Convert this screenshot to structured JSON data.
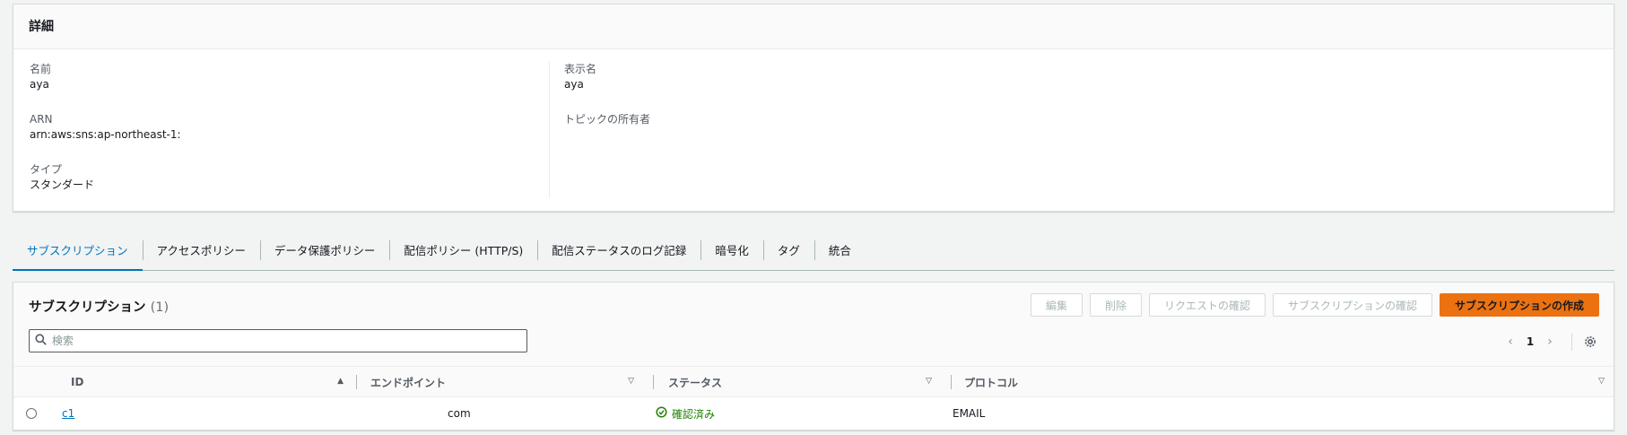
{
  "details": {
    "title": "詳細",
    "name_label": "名前",
    "name_value": "aya",
    "arn_label": "ARN",
    "arn_value": "arn:aws:sns:ap-northeast-1:",
    "type_label": "タイプ",
    "type_value": "スタンダード",
    "display_name_label": "表示名",
    "display_name_value": "aya",
    "owner_label": "トピックの所有者",
    "owner_value": ""
  },
  "tabs": [
    {
      "label": "サブスクリプション"
    },
    {
      "label": "アクセスポリシー"
    },
    {
      "label": "データ保護ポリシー"
    },
    {
      "label": "配信ポリシー (HTTP/S)"
    },
    {
      "label": "配信ステータスのログ記録"
    },
    {
      "label": "暗号化"
    },
    {
      "label": "タグ"
    },
    {
      "label": "統合"
    }
  ],
  "subscriptions": {
    "title": "サブスクリプション",
    "count": "(1)",
    "buttons": {
      "edit": "編集",
      "delete": "削除",
      "confirm_request": "リクエストの確認",
      "confirm_subscription": "サブスクリプションの確認",
      "create": "サブスクリプションの作成"
    },
    "search_placeholder": "検索",
    "page": "1",
    "columns": {
      "id": "ID",
      "endpoint": "エンドポイント",
      "status": "ステータス",
      "protocol": "プロトコル"
    },
    "rows": [
      {
        "id": "c1",
        "endpoint": "com",
        "status": "確認済み",
        "protocol": "EMAIL"
      }
    ]
  },
  "colors": {
    "accent": "#0073bb",
    "primary_button": "#ec7211",
    "success": "#1d8102"
  }
}
